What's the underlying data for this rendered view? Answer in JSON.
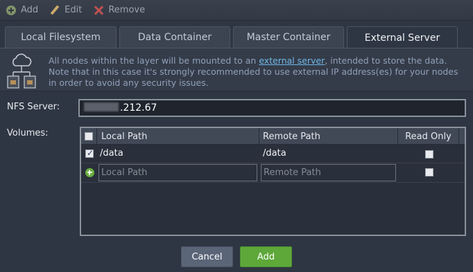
{
  "toolbar": {
    "add_label": "Add",
    "edit_label": "Edit",
    "remove_label": "Remove"
  },
  "tabs": [
    {
      "label": "Local Filesystem",
      "active": false
    },
    {
      "label": "Data Container",
      "active": false
    },
    {
      "label": "Master Container",
      "active": false
    },
    {
      "label": "External Server",
      "active": true
    }
  ],
  "info": {
    "text_before_link": "All nodes within the layer will be mounted to an ",
    "link_text": "external server",
    "text_after_link": ", intended to store the data. Note that in this case it's strongly recommended to use external IP address(es) for your nodes in order to avoid any security issues."
  },
  "form": {
    "nfs_label": "NFS Server:",
    "nfs_value_visible": ".212.67",
    "volumes_label": "Volumes:"
  },
  "volumes_grid": {
    "columns": {
      "local_path": "Local Path",
      "remote_path": "Remote Path",
      "read_only": "Read Only"
    },
    "rows": [
      {
        "selected": true,
        "local_path": "/data",
        "remote_path": "/data",
        "read_only": false
      }
    ],
    "new_row": {
      "local_placeholder": "Local Path",
      "remote_placeholder": "Remote Path",
      "read_only": false
    }
  },
  "buttons": {
    "cancel": "Cancel",
    "add": "Add"
  },
  "colors": {
    "accent_green": "#5ea83a",
    "link": "#6fb8e8",
    "background": "#2f3643"
  }
}
